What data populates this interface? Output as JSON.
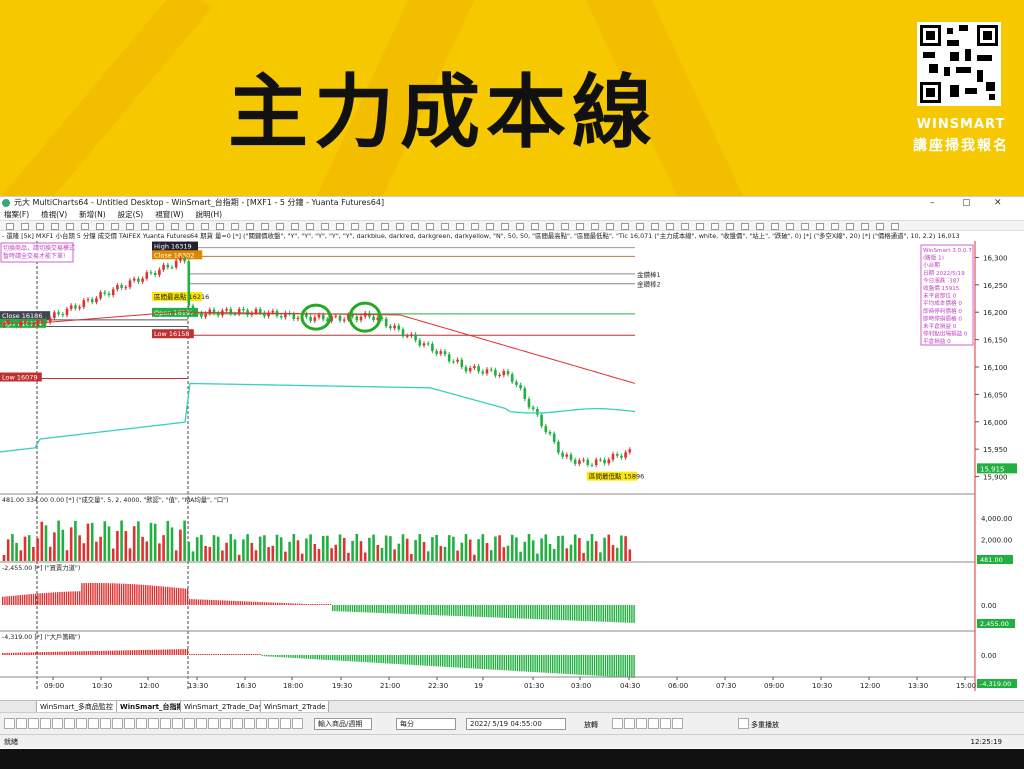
{
  "banner": {
    "title": "主力成本線",
    "brand": "WINSMART",
    "cta": "講座掃我報名"
  },
  "window": {
    "title": "元大 MultiCharts64 - Untitled Desktop - WinSmart_台指期 - [MXF1 - 5 分鐘 - Yuanta Futures64]",
    "controls": {
      "min": "–",
      "max": "▢",
      "close": "✕"
    },
    "menu": [
      "檔案(F)",
      "檢視(V)",
      "新增(N)",
      "設定(S)",
      "視窗(W)",
      "說明(H)"
    ],
    "status_line": "- 還隆  [5k] MXF1  小台期  5 分鐘  成交價  TAIFEX  Yuanta Futures64  期貨  量=0  [*] (\"關鍵價收盤\", \"Y\", \"Y\", \"Y\", \"Y\", \"Y\", darkblue, darkred, darkgreen, darkyellow, \"N\", 50, 50, \"區間最高點\", \"區間最低點\", \"Tic  16,071  (\"主力成本線\", white, \"收盤價\", \"站上\", \"跌破\", 0)  [*] (\"多空X線\", 20)  [*] (\"價格通道\", 10, 2.2)  16,013"
  },
  "chart_data": {
    "type": "line",
    "price_axis": {
      "ticks": [
        "16,300",
        "16,250",
        "16,200",
        "16,150",
        "16,100",
        "16,050",
        "16,000",
        "15,950",
        "15,900"
      ],
      "last": "15,915"
    },
    "time_axis": [
      "09:00",
      "10:30",
      "12:00",
      "13:30",
      "16:30",
      "18:00",
      "19:30",
      "21:00",
      "22:30",
      "19",
      "01:30",
      "03:00",
      "04:30",
      "06:00",
      "07:30",
      "09:00",
      "10:30",
      "12:00",
      "13:30",
      "15:00"
    ],
    "labels": {
      "high": "High 16319",
      "close": "Close 16302",
      "range_low_top": "區間最高點 16216",
      "open": "Open 16197",
      "low": "Low 16158",
      "low_prev": "Low 16079",
      "close_prev": "Close 16186",
      "open_prev": "Open 16174",
      "gold1": "金鑽棒1",
      "gold2": "金鑽棒2",
      "range_low": "區間最低點 15896"
    },
    "notice": [
      "切換商品，請切換交易模式",
      "暫時請全交易才能下單!"
    ],
    "info_box": [
      "WinSmart 3.0.0.7",
      "(贈版 1)",
      "小台期",
      "日期 2022/5/19",
      "今日漲跌 -387",
      "收盤價 15915",
      "未平倉部位 0",
      "平均成本價格 0",
      "即時停利價格 0",
      "即時停損價格 0",
      "未平倉損益 0",
      "停利點出場損益 0",
      "平倉損益 0"
    ],
    "volume": {
      "header": "481.00  334.00  0.00  [*] (\"成交量\", 5, 2, 4000, \"默認\", \"值\", \"MA均量\", \"口\")",
      "ticks": [
        "4,000.00",
        "2,000.00",
        "0.00"
      ],
      "last": "481.00"
    },
    "power": {
      "header": "-2,455.00  [*] (\"買賣力道\")",
      "ticks": [
        "0.00"
      ],
      "last": "2,455.00"
    },
    "big": {
      "header": "-4,319.00  [*] (\"大戶籌碼\")",
      "ticks": [
        "0.00"
      ],
      "last": "-4,319.00"
    }
  },
  "tabs": [
    "WinSmart_多商品監控",
    "WinSmart_台指期",
    "WinSmart_2Trade_DayK",
    "WinSmart_2Trade"
  ],
  "bottom_toolbar": {
    "symbol_placeholder": "輸入商品/週期",
    "interval": "每分",
    "datetime": "2022/ 5/19 04:55:00",
    "replay": "放轉",
    "multi": "多重播放"
  },
  "status": {
    "text": "就緒",
    "time": "12:25:19"
  },
  "colors": {
    "banner": "#f6c800",
    "ma": "#e03030",
    "channel": "#38d0c0",
    "up": "#e03030",
    "down": "#20b040",
    "circle": "#22aa22"
  }
}
